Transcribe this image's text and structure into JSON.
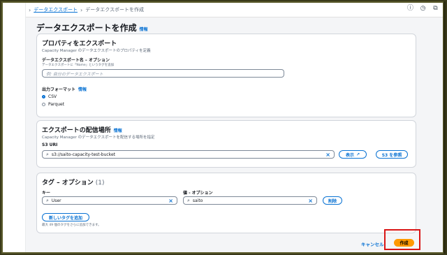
{
  "breadcrumb": {
    "parent": "データエクスポート",
    "current": "データエクスポートを作成"
  },
  "page": {
    "title": "データエクスポートを作成",
    "info": "情報"
  },
  "properties": {
    "title": "プロパティをエクスポート",
    "description": "Capacity Manager のデータエクスポートのプロパティを定義",
    "name_label": "データエクスポート名 – オプション",
    "name_hint": "データエクスポートに「Name」というタグを追加",
    "name_placeholder": "例: 自分のデータエクスポート",
    "format_label": "出力フォーマット",
    "format_info": "情報",
    "format_options": [
      "CSV",
      "Parquet"
    ],
    "format_selected": "CSV"
  },
  "delivery": {
    "title": "エクスポートの配信場所",
    "info": "情報",
    "description": "Capacity Manager のデータエクスポートを配信する場所を指定",
    "s3_label": "S3 URI",
    "s3_value": "s3://saito-capacity-test-bucket",
    "view_button": "表示",
    "browse_button": "S3 を参照"
  },
  "tags": {
    "title": "タグ – オプション",
    "count": "(1)",
    "key_label": "キー",
    "value_label": "値 - オプション",
    "key_value": "User",
    "value_value": "saito",
    "remove_button": "削除",
    "add_button": "新しいタグを追加",
    "hint": "最大 49 個のタグをさらに追加できます。"
  },
  "footer": {
    "cancel": "キャンセル",
    "create": "作成"
  },
  "colors": {
    "link": "#0972d3",
    "primary": "#ff9900",
    "highlight": "#d91515"
  }
}
